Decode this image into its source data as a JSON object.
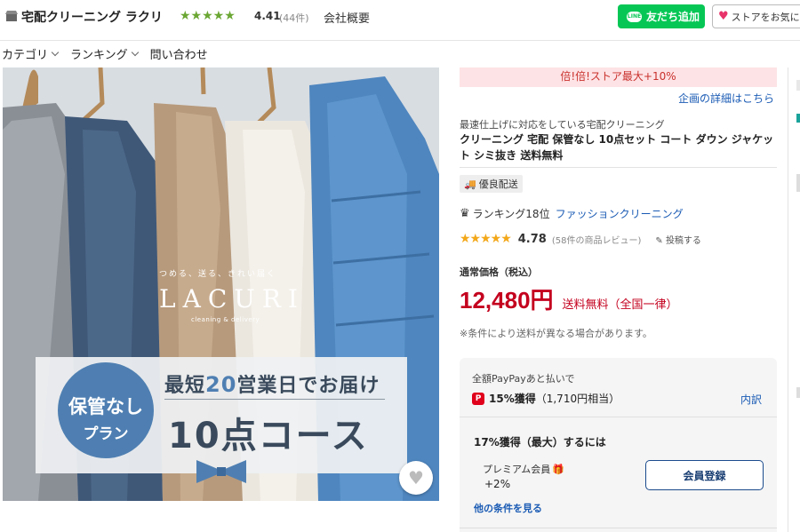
{
  "header": {
    "store_name": "宅配クリーニング ラクリ",
    "stars": "★★★★★",
    "rating": "4.41",
    "review_count": "(44件)",
    "company_link": "会社概要",
    "line_badge": "LINE",
    "line_button": "友だち追加",
    "favorite_button": "ストアをお気に入り"
  },
  "nav": {
    "items": [
      {
        "label": "カテゴリ",
        "has_dropdown": true
      },
      {
        "label": "ランキング",
        "has_dropdown": true
      },
      {
        "label": "問い合わせ",
        "has_dropdown": false
      }
    ]
  },
  "image": {
    "tagline": "つめる、送る、きれい届く",
    "logo": "LACURI",
    "logo_sub": "cleaning & delivery",
    "plan_line1": "保管なし",
    "plan_line2": "プラン",
    "promo_prefix": "最短",
    "promo_number": "20",
    "promo_suffix": "営業日でお届け",
    "course": "10点コース"
  },
  "product": {
    "campaign_bar": "倍!倍!ストア最大+10%",
    "campaign_link": "企画の詳細はこちら",
    "catchcopy": "最速仕上げに対応をしている宅配クリーニング",
    "title": "クリーニング 宅配 保管なし 10点セット コート ダウン ジャケット シミ抜き 送料無料",
    "delivery_badge": "優良配送",
    "ranking": "ランキング18位",
    "ranking_category": "ファッションクリーニング",
    "review_stars": "★★★★★",
    "review_score": "4.78",
    "review_count": "(58件の商品レビュー)",
    "post_review": "投稿する",
    "price_label": "通常価格（税込）",
    "price": "12,480円",
    "shipping": "送料無料",
    "shipping_note": "（全国一律）",
    "shipping_condition": "※条件により送料が異なる場合があります。"
  },
  "points": {
    "label": "全額PayPayあと払いで",
    "earn_rate": "15%獲得",
    "earn_amount": "（1,710円相当）",
    "detail_link": "内訳",
    "max_text": "17%獲得（最大）するには",
    "premium_label": "プレミアム会員",
    "premium_bonus": "+2%",
    "member_button": "会員登録",
    "more_conditions": "他の条件を見る"
  },
  "colors": {
    "line_green": "#06c755",
    "price_red": "#c4001e",
    "link_blue": "#1a5bb4",
    "campaign_bg": "#fde3e5",
    "rating_green": "#6aa632",
    "review_star": "#f3a81a"
  }
}
